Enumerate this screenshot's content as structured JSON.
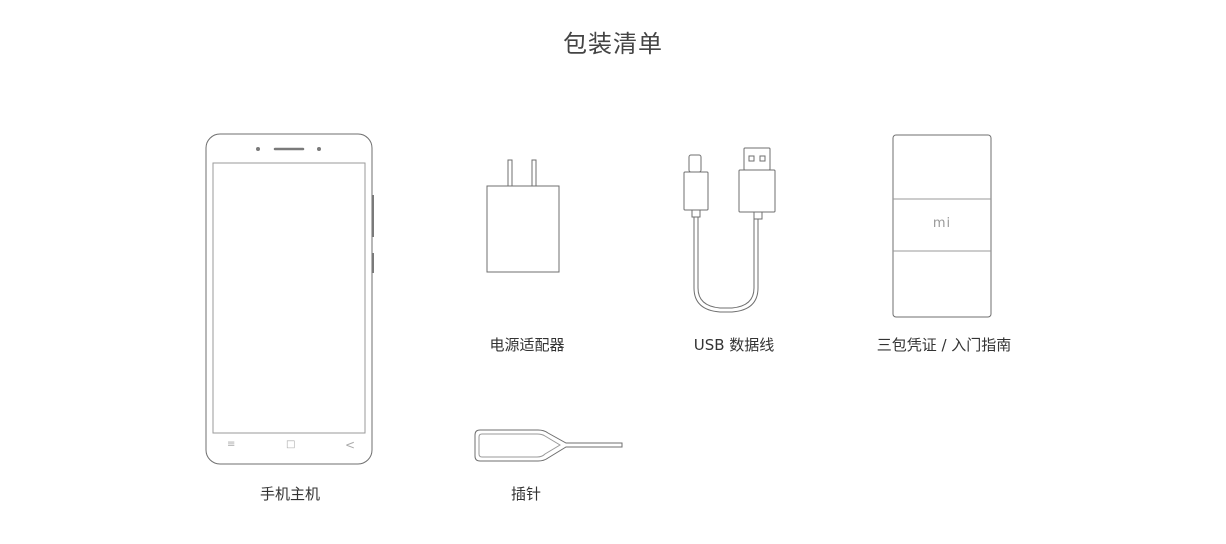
{
  "page": {
    "title": "包装清单"
  },
  "items": [
    {
      "name": "phone",
      "label": "手机主机"
    },
    {
      "name": "charger",
      "label": "电源适配器"
    },
    {
      "name": "usb-cable",
      "label": "USB 数据线"
    },
    {
      "name": "sim-pin",
      "label": "插针"
    },
    {
      "name": "booklet",
      "label": "三包凭证 / 入门指南"
    }
  ],
  "booklet": {
    "logo_text": "mi"
  },
  "phone": {
    "nav_buttons": [
      "≡",
      "□",
      "<"
    ]
  }
}
